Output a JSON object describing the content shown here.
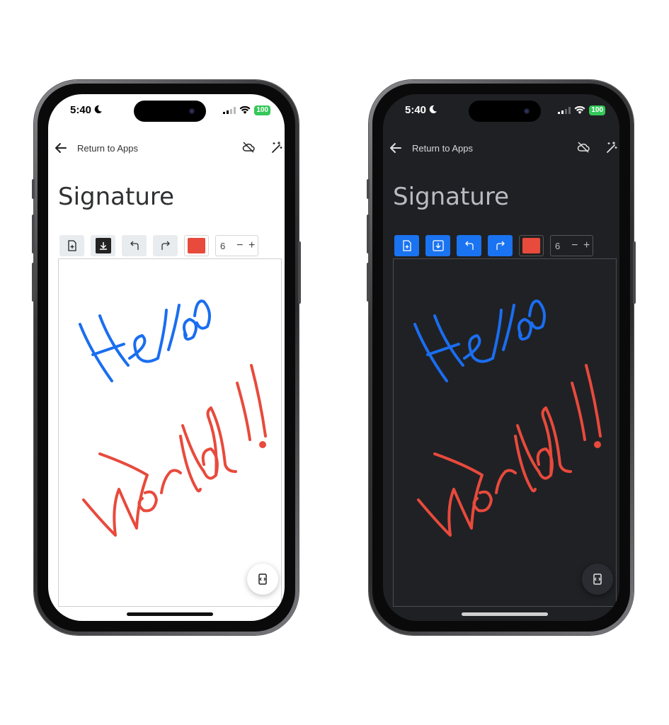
{
  "status": {
    "time": "5:40",
    "battery": "100"
  },
  "nav": {
    "back_label": "Return to Apps"
  },
  "page": {
    "title": "Signature"
  },
  "toolbar": {
    "new_label": "new-document",
    "save_label": "download",
    "stroke_size": "6",
    "minus": "−",
    "plus": "+",
    "current_color": "#e84a3c"
  },
  "drawing": {
    "line1_color": "#1a6ef0",
    "line2_color": "#e84a3c"
  }
}
